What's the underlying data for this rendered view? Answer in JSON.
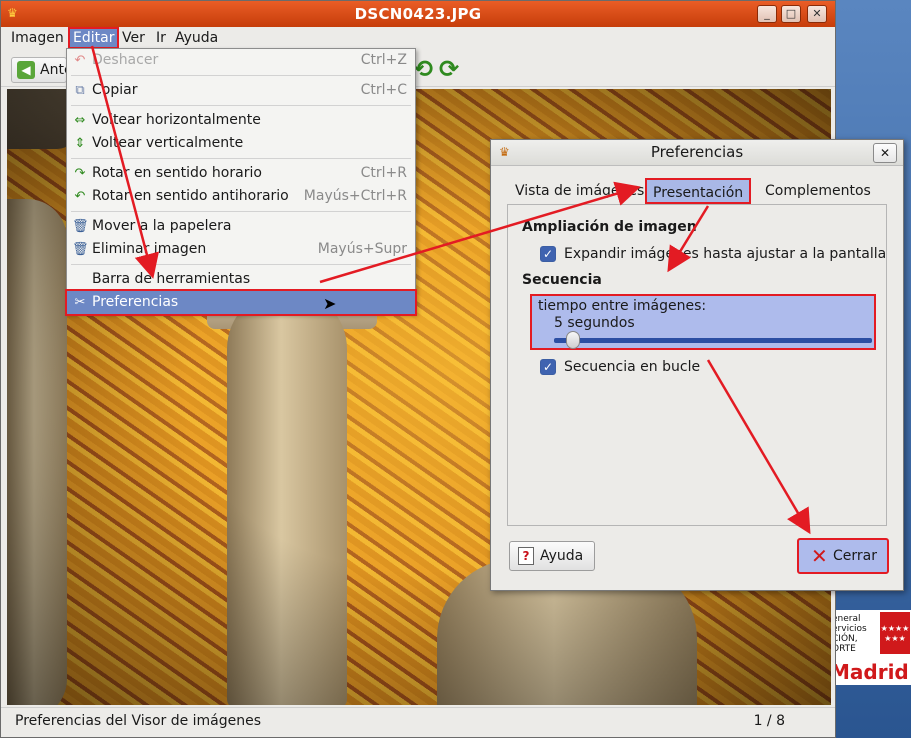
{
  "window": {
    "title": "DSCN0423.JPG",
    "controls": [
      "_",
      "□",
      "✕"
    ]
  },
  "menubar": [
    "Imagen",
    "Editar",
    "Ver",
    "Ir",
    "Ayuda"
  ],
  "toolbar": {
    "prev_label": "Anterior"
  },
  "edit_menu": {
    "items": [
      {
        "label": "Deshacer",
        "accel": "Ctrl+Z",
        "icon": "undo-icon",
        "disabled": true
      },
      {
        "label": "Copiar",
        "accel": "Ctrl+C",
        "icon": "copy-icon"
      },
      {
        "label": "Voltear horizontalmente",
        "accel": "",
        "icon": "flip-horizontal-icon"
      },
      {
        "label": "Voltear verticalmente",
        "accel": "",
        "icon": "flip-vertical-icon"
      },
      {
        "label": "Rotar en sentido horario",
        "accel": "Ctrl+R",
        "icon": "rotate-clockwise-icon"
      },
      {
        "label": "Rotar en sentido antihorario",
        "accel": "Mayús+Ctrl+R",
        "icon": "rotate-counterclockwise-icon"
      },
      {
        "label": "Mover a la papelera",
        "accel": "",
        "icon": "trash-icon"
      },
      {
        "label": "Eliminar imagen",
        "accel": "Mayús+Supr",
        "icon": "delete-icon"
      },
      {
        "label": "Barra de herramientas",
        "accel": "",
        "icon": ""
      },
      {
        "label": "Preferencias",
        "accel": "",
        "icon": "preferences-icon",
        "selected": true
      }
    ]
  },
  "preferences": {
    "title": "Preferencias",
    "tabs": [
      "Vista de imágenes",
      "Presentación",
      "Complementos"
    ],
    "active_tab": "Presentación",
    "zoom_heading": "Ampliación de imagen",
    "expand_label": "Expandir imágenes hasta ajustar a la pantalla",
    "expand_checked": true,
    "sequence_heading": "Secuencia",
    "interval_label": "tiempo entre imágenes:",
    "interval_value": "5 segundos",
    "interval_fraction": 0.06,
    "loop_label": "Secuencia en bucle",
    "loop_checked": true,
    "help_button": "Ayuda",
    "close_button": "Cerrar"
  },
  "statusbar": {
    "message": "Preferencias del Visor de imágenes",
    "position": "1 / 8"
  },
  "desktop_logo": {
    "small_text": "eneral\nervicios\nCIÓN,\nORTE",
    "city": "Madrid"
  },
  "colors": {
    "titlebar": "#d94a16",
    "selection": "#6d88c5",
    "annotation": "#e31b23"
  }
}
